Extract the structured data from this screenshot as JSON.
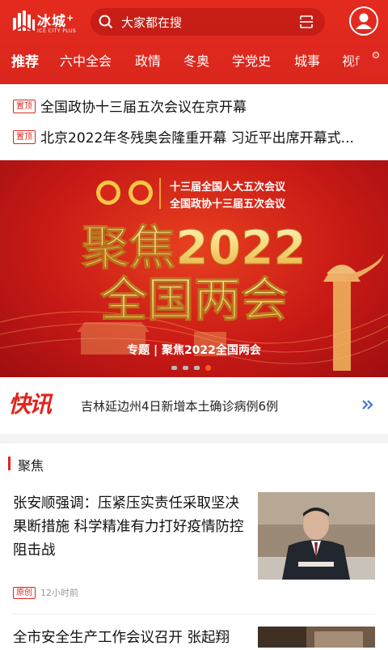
{
  "header": {
    "logo_text": "冰城",
    "logo_plus": "+",
    "logo_sub": "ICE CITY PLUS",
    "search_placeholder": "大家都在搜",
    "tabs": [
      "推荐",
      "六中全会",
      "政情",
      "冬奥",
      "学党史",
      "城事",
      "视f"
    ]
  },
  "pinned": [
    {
      "badge": "置顶",
      "title": "全国政协十三届五次会议在京开幕"
    },
    {
      "badge": "置顶",
      "title": "北京2022年冬残奥会隆重开幕 习近平出席开幕式..."
    }
  ],
  "banner": {
    "line1": "十三届全国人大五次会议",
    "line2": "全国政协十三届五次会议",
    "big1": "聚焦2022",
    "big2": "全国两会",
    "caption": "专题 | 聚焦2022全国两会",
    "page_count": 4,
    "active_page": 4
  },
  "flash": {
    "label": "快讯",
    "text": "吉林延边州4日新增本土确诊病例6例"
  },
  "section": {
    "title": "聚焦"
  },
  "news": [
    {
      "title": "张安顺强调：压紧压实责任采取坚决果断措施 科学精准有力打好疫情防控阻击战",
      "badge": "原创",
      "time": "12小时前"
    },
    {
      "title": "全市安全生产工作会议召开 张起翔",
      "badge": "",
      "time": ""
    }
  ],
  "colors": {
    "brand": "#d9261c",
    "accent": "#e0241c"
  }
}
